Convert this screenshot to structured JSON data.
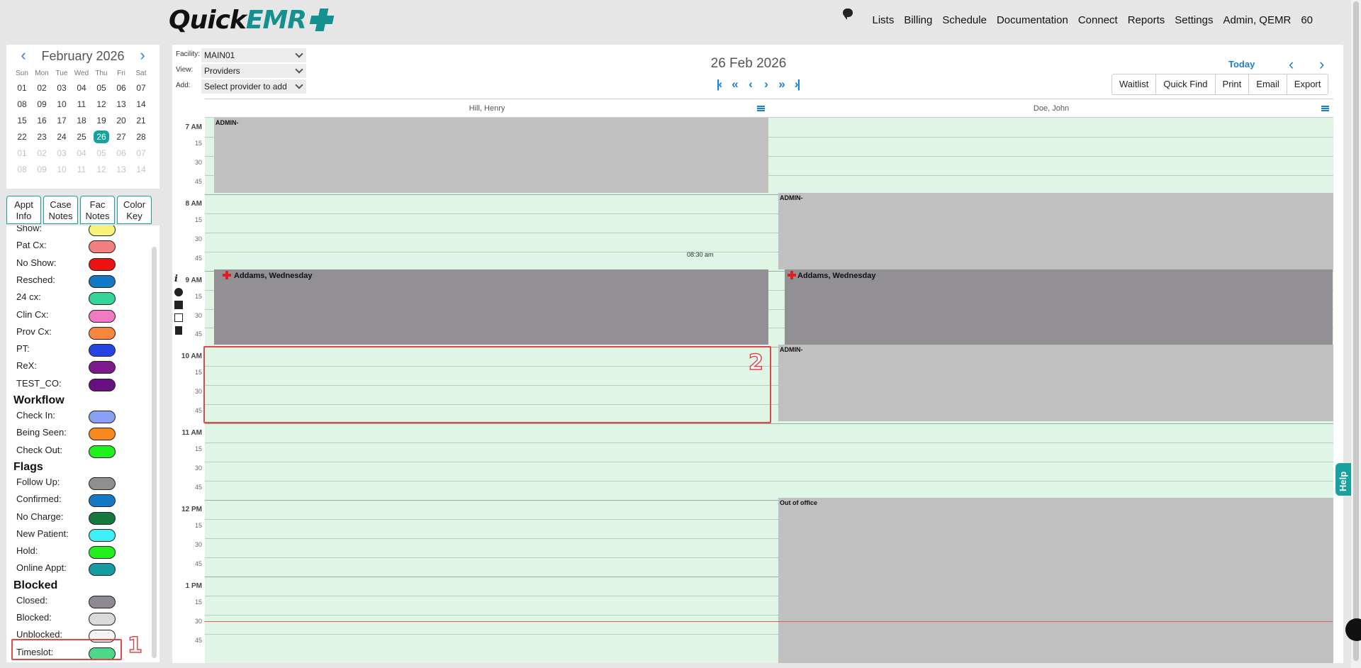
{
  "brand": {
    "quick": "Quick",
    "emr": "EMR"
  },
  "nav": {
    "items": [
      "Lists",
      "Billing",
      "Schedule",
      "Documentation",
      "Connect",
      "Reports",
      "Settings",
      "Admin, QEMR",
      "60"
    ]
  },
  "mini_calendar": {
    "month": "February 2026",
    "days_of_week": [
      "Sun",
      "Mon",
      "Tue",
      "Wed",
      "Thu",
      "Fri",
      "Sat"
    ],
    "weeks": [
      [
        "01",
        "02",
        "03",
        "04",
        "05",
        "06",
        "07"
      ],
      [
        "08",
        "09",
        "10",
        "11",
        "12",
        "13",
        "14"
      ],
      [
        "15",
        "16",
        "17",
        "18",
        "19",
        "20",
        "21"
      ],
      [
        "22",
        "23",
        "24",
        "25",
        "26",
        "27",
        "28"
      ],
      [
        "01",
        "02",
        "03",
        "04",
        "05",
        "06",
        "07"
      ],
      [
        "08",
        "09",
        "10",
        "11",
        "12",
        "13",
        "14"
      ]
    ],
    "selected": "26"
  },
  "side_tabs": {
    "appt_info": [
      "Appt",
      "Info"
    ],
    "case_notes": [
      "Case",
      "Notes"
    ],
    "fac_notes": [
      "Fac",
      "Notes"
    ],
    "color_key": [
      "Color",
      "Key"
    ]
  },
  "legend": {
    "status": [
      {
        "label": "Show:",
        "color": "#f7f27a"
      },
      {
        "label": "Pat Cx:",
        "color": "#f28080"
      },
      {
        "label": "No Show:",
        "color": "#ee1111"
      },
      {
        "label": "Resched:",
        "color": "#1479c4"
      },
      {
        "label": "24 cx:",
        "color": "#35d49a"
      },
      {
        "label": "Clin Cx:",
        "color": "#f27ac4"
      },
      {
        "label": "Prov Cx:",
        "color": "#f78740"
      },
      {
        "label": "PT:",
        "color": "#2545e0"
      },
      {
        "label": "ReX:",
        "color": "#7d1a8a"
      },
      {
        "label": "TEST_CO:",
        "color": "#6a0f80"
      }
    ],
    "workflow_title": "Workflow",
    "workflow": [
      {
        "label": "Check In:",
        "color": "#8aa0f5"
      },
      {
        "label": "Being Seen:",
        "color": "#f7881e"
      },
      {
        "label": "Check Out:",
        "color": "#22f01e"
      }
    ],
    "flags_title": "Flags",
    "flags": [
      {
        "label": "Follow Up:",
        "color": "#8f8f8f"
      },
      {
        "label": "Confirmed:",
        "color": "#1479c4"
      },
      {
        "label": "No Charge:",
        "color": "#167a40"
      },
      {
        "label": "New Patient:",
        "color": "#3ef0f5"
      },
      {
        "label": "Hold:",
        "color": "#22f01e"
      },
      {
        "label": "Online Appt:",
        "color": "#169ca0"
      }
    ],
    "blocked_title": "Blocked",
    "blocked": [
      {
        "label": "Closed:",
        "color": "#8f8a92"
      },
      {
        "label": "Blocked:",
        "color": "#dadada"
      },
      {
        "label": "Unblocked:",
        "color": "#f4f4f4"
      },
      {
        "label": "Timeslot:",
        "color": "#4bd88b"
      }
    ]
  },
  "controls": {
    "facility_label": "Facility:",
    "facility_value": "MAIN01",
    "view_label": "View:",
    "view_value": "Providers",
    "add_label": "Add:",
    "add_value": "Select provider to add"
  },
  "date_title": "26 Feb 2026",
  "today_label": "Today",
  "buttons": [
    "Waitlist",
    "Quick Find",
    "Print",
    "Email",
    "Export"
  ],
  "providers": [
    "Hill, Henry",
    "Doe, John"
  ],
  "time_labels": [
    {
      "hour": "7 AM",
      "mins": [
        "15",
        "30",
        "45"
      ]
    },
    {
      "hour": "8 AM",
      "mins": [
        "15",
        "30",
        "45"
      ]
    },
    {
      "hour": "9 AM",
      "mins": [
        "15",
        "30",
        "45"
      ]
    },
    {
      "hour": "10 AM",
      "mins": [
        "15",
        "30",
        "45"
      ]
    },
    {
      "hour": "11 AM",
      "mins": [
        "15",
        "30",
        "45"
      ]
    },
    {
      "hour": "12 PM",
      "mins": [
        "15",
        "30",
        "45"
      ]
    },
    {
      "hour": "1 PM",
      "mins": [
        "15",
        "30",
        "45"
      ]
    }
  ],
  "events": {
    "hill_admin": "ADMIN-",
    "hill_time_note": "08:30 am",
    "hill_appt": "Addams, Wednesday",
    "doe_admin_8": "ADMIN-",
    "doe_appt": "Addams, Wednesday",
    "doe_admin_10": "ADMIN-",
    "doe_out": "Out of office"
  },
  "annotations": {
    "one": "1",
    "two": "2"
  },
  "help_label": "Help"
}
